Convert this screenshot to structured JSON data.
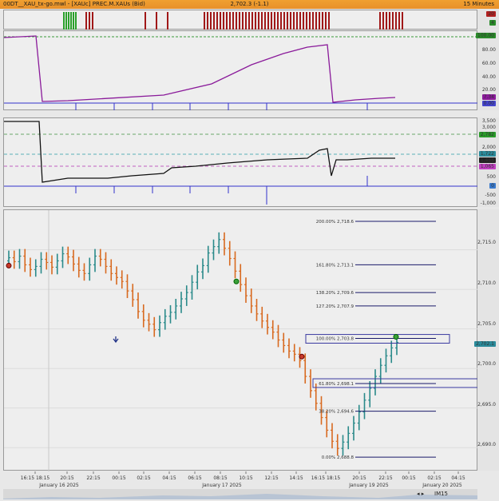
{
  "window": {
    "title": "00DT__XAU_tx-go.mwl - [XAUc] PREC.M.XAUs (Bid)",
    "price_readout": "2,702.3 (-1.1)",
    "timeframe": "15 Minutes"
  },
  "panel1": {
    "axis_labels": [
      "100.00",
      "80.00",
      "60.00",
      "40.00",
      "20.00"
    ],
    "value_badges": [
      "100.00",
      "7.34",
      "0.00"
    ],
    "top_badges": [
      "20",
      "4"
    ]
  },
  "panel2": {
    "axis_labels": [
      "3,500",
      "3,000",
      "2,500",
      "2,000",
      "1,500",
      "1,000",
      "500",
      "0",
      "-500",
      "-1,000"
    ],
    "value_badges": [
      "2,782",
      "1,722",
      "1,468",
      "1,065",
      "0"
    ]
  },
  "main_chart": {
    "axis_labels": [
      "2,715.0",
      "2,710.0",
      "2,705.0",
      "2,700.0",
      "2,695.0",
      "2,690.0"
    ],
    "price_badge": "2,702.1",
    "fib_levels": [
      {
        "label": "200.00% 2,718.6",
        "price": 2718.6
      },
      {
        "label": "161.80% 2,713.1",
        "price": 2713.1
      },
      {
        "label": "138.20% 2,709.6",
        "price": 2709.6
      },
      {
        "label": "127.20% 2,707.9",
        "price": 2707.9
      },
      {
        "label": "100.00% 2,703.8",
        "price": 2703.8
      },
      {
        "label": "61.80% 2,698.1",
        "price": 2698.1
      },
      {
        "label": "38.20% 2,694.6",
        "price": 2694.6
      },
      {
        "label": "0.00% 2,688.8",
        "price": 2688.8
      }
    ]
  },
  "time_axis": {
    "ticks": [
      "16:15 18:15",
      "20:15",
      "22:15",
      "00:15",
      "02:15",
      "04:15",
      "06:15",
      "08:15",
      "10:15",
      "12:15",
      "14:15",
      "16:15 18:15",
      "20:15",
      "22:15",
      "00:15",
      "02:15",
      "04:15"
    ],
    "dates": [
      "January 16 2025",
      "January 17 2025",
      "January 19 2025",
      "January 20 2025"
    ]
  },
  "status": {
    "symbol_label": "IM15"
  },
  "colors": {
    "title_bg": "#e8902a",
    "up_bar": "#2a8a8a",
    "down_bar": "#d86a20",
    "neutral_bar": "#9fb4c8",
    "fib_line": "#1a1a6a",
    "osc_line": "#8a1a9a",
    "cum_line": "#111111"
  }
}
